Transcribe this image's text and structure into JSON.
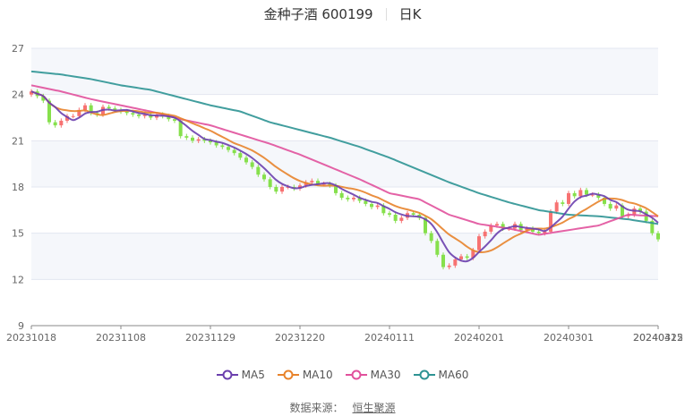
{
  "header": {
    "stock": "金种子酒 600199",
    "period": "日K"
  },
  "source": {
    "label": "数据来源：",
    "provider": "恒生聚源"
  },
  "colors": {
    "up": "#f77272",
    "down": "#86e04c",
    "MA5": "#6b3fae",
    "MA10": "#e8832b",
    "MA30": "#e1519c",
    "MA60": "#2e9393",
    "grid": "#e3e7f0",
    "band": "#f5f7fb"
  },
  "chart_data": {
    "type": "candlestick",
    "title": "金种子酒 600199 日K",
    "ylim": [
      9,
      27
    ],
    "yticks": [
      "9",
      "12",
      "15",
      "18",
      "21",
      "24",
      "27"
    ],
    "xtick_labels": [
      "20231018",
      "20231108",
      "20231129",
      "20231220",
      "20240111",
      "20240201",
      "20240301",
      "20240322",
      "20240415"
    ],
    "xtick_every": 15,
    "legend": [
      "MA5",
      "MA10",
      "MA30",
      "MA60"
    ],
    "legend_position": "bottom",
    "close": [
      24.2,
      23.9,
      23.6,
      22.2,
      22.0,
      22.3,
      22.6,
      22.6,
      23.0,
      23.3,
      22.8,
      22.7,
      23.2,
      23.1,
      23.0,
      22.9,
      22.8,
      22.7,
      22.6,
      22.7,
      22.5,
      22.7,
      22.6,
      22.4,
      22.3,
      21.3,
      21.2,
      21.0,
      21.1,
      21.0,
      20.9,
      20.7,
      20.6,
      20.4,
      20.2,
      19.9,
      19.6,
      19.3,
      18.8,
      18.5,
      18.0,
      17.7,
      18.0,
      18.0,
      17.9,
      18.1,
      18.3,
      18.4,
      18.2,
      18.2,
      18.1,
      17.6,
      17.3,
      17.2,
      17.3,
      17.1,
      16.9,
      16.7,
      16.8,
      16.3,
      16.2,
      15.8,
      16.0,
      16.3,
      16.2,
      16.0,
      15.0,
      14.5,
      13.6,
      12.8,
      12.9,
      13.3,
      13.5,
      13.4,
      13.9,
      14.8,
      15.1,
      15.5,
      15.6,
      15.3,
      15.3,
      15.6,
      15.2,
      15.3,
      15.1,
      15.0,
      15.1,
      16.4,
      17.0,
      16.9,
      17.6,
      17.4,
      17.8,
      17.5,
      17.5,
      17.3,
      16.9,
      16.6,
      16.8,
      16.1,
      16.2,
      16.6,
      16.4,
      15.8,
      15.0,
      14.6
    ],
    "open": [
      24.0,
      24.2,
      23.9,
      23.6,
      22.2,
      22.0,
      22.3,
      22.6,
      22.6,
      23.0,
      23.3,
      22.8,
      22.7,
      23.2,
      23.1,
      23.0,
      22.9,
      22.8,
      22.7,
      22.6,
      22.7,
      22.5,
      22.7,
      22.6,
      22.4,
      22.3,
      21.3,
      21.2,
      21.0,
      21.1,
      21.0,
      20.9,
      20.7,
      20.6,
      20.4,
      20.2,
      19.9,
      19.6,
      19.3,
      18.8,
      18.5,
      18.0,
      17.7,
      18.0,
      18.0,
      17.9,
      18.1,
      18.3,
      18.4,
      18.2,
      18.2,
      18.1,
      17.6,
      17.3,
      17.2,
      17.3,
      17.1,
      16.9,
      16.7,
      16.8,
      16.3,
      16.2,
      15.8,
      16.0,
      16.3,
      16.2,
      16.0,
      15.0,
      14.5,
      13.6,
      12.8,
      12.9,
      13.3,
      13.5,
      13.4,
      13.9,
      14.8,
      15.1,
      15.5,
      15.6,
      15.3,
      15.3,
      15.6,
      15.2,
      15.3,
      15.1,
      15.0,
      15.1,
      16.4,
      17.0,
      16.9,
      17.6,
      17.4,
      17.8,
      17.5,
      17.5,
      17.3,
      16.9,
      16.6,
      16.8,
      16.1,
      16.2,
      16.6,
      16.4,
      15.8,
      15.0
    ],
    "ma30_every5": [
      24.6,
      24.2,
      23.7,
      23.3,
      22.9,
      22.4,
      22.0,
      21.4,
      20.8,
      20.1,
      19.3,
      18.5,
      17.6,
      17.2,
      16.2,
      15.6,
      15.3,
      14.9,
      15.2,
      15.5,
      16.2,
      16.1
    ],
    "ma60_every5": [
      25.5,
      25.3,
      25.0,
      24.6,
      24.3,
      23.8,
      23.3,
      22.9,
      22.2,
      21.7,
      21.2,
      20.6,
      19.9,
      19.1,
      18.3,
      17.6,
      17.0,
      16.5,
      16.2,
      16.1,
      15.9,
      15.6
    ]
  }
}
